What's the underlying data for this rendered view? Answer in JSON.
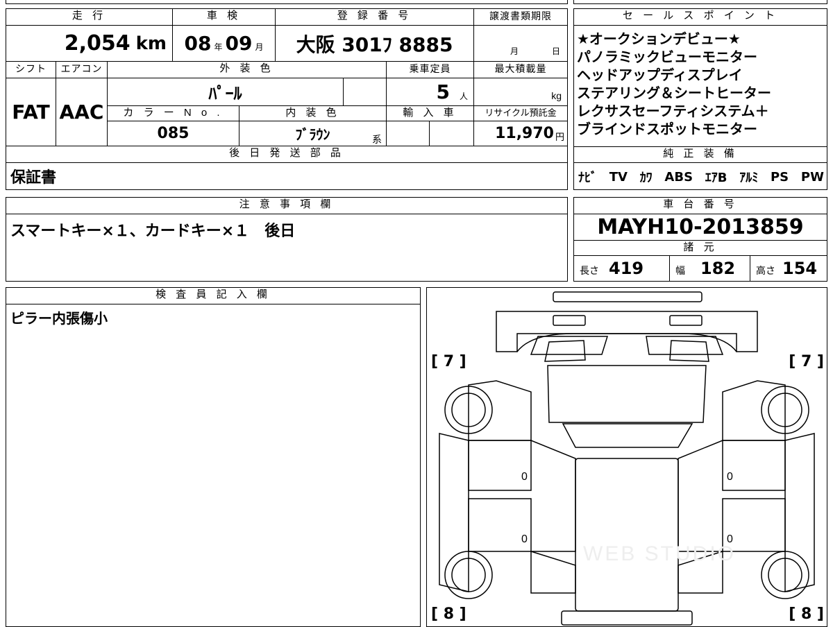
{
  "top": {
    "mileage_label": "走 行",
    "mileage_value": "2,054",
    "mileage_unit": "km",
    "shaken_label": "車 検",
    "shaken_year": "08",
    "shaken_year_unit": "年",
    "shaken_month": "09",
    "shaken_month_unit": "月",
    "reg_label": "登 録 番 号",
    "reg_value": "大阪 301ﾌ 8885",
    "deadline_label": "譲渡書類期限",
    "deadline_month_unit": "月",
    "deadline_day_unit": "日",
    "shift_label": "シフト",
    "shift_value": "FAT",
    "ac_label": "エアコン",
    "ac_value": "AAC",
    "exterior_label": "外 装 色",
    "exterior_value": "ﾊﾟｰﾙ",
    "capacity_label": "乗車定員",
    "capacity_value": "5",
    "capacity_unit": "人",
    "maxload_label": "最大積載量",
    "maxload_unit": "kg",
    "color_no_label": "カ ラ ー N o .",
    "color_no_value": "085",
    "interior_label": "内 装 色",
    "interior_value": "ﾌﾞﾗｳﾝ",
    "interior_suffix": "系",
    "import_label": "輸 入 車",
    "recycle_label": "リサイクル預託金",
    "recycle_value": "11,970",
    "recycle_unit": "円",
    "later_label": "後 日 発 送 部 品",
    "later_value": "保証書"
  },
  "sales": {
    "label": "セ ー ル ス ポ イ ン ト",
    "points": [
      "★オークションデビュー★",
      "パノラミックビューモニター",
      "ヘッドアップディスプレイ",
      "ステアリング＆シートヒーター",
      "レクサスセーフティシステム＋",
      "ブラインドスポットモニター"
    ]
  },
  "equipment": {
    "label": "純 正 装 備",
    "items": [
      "ﾅﾋﾞ",
      "TV",
      "ｶﾜ",
      "ABS",
      "ｴｱB",
      "ｱﾙﾐ",
      "PS",
      "PW"
    ]
  },
  "notes": {
    "label": "注 意 事 項 欄",
    "value": "スマートキー×１、カードキー×１　後日"
  },
  "chassis": {
    "label": "車 台 番 号",
    "value": "MAYH10-2013859"
  },
  "specs": {
    "label": "諸 元",
    "length_label": "長さ",
    "length_value": "419",
    "width_label": "幅",
    "width_value": "182",
    "height_label": "高さ",
    "height_value": "154"
  },
  "inspector": {
    "label": "検 査 員 記 入 欄",
    "value": "ピラー内張傷小"
  },
  "diagram": {
    "corner_tl": "[ 7 ]",
    "corner_tr": "[ 7 ]",
    "corner_bl": "[ 8 ]",
    "corner_br": "[ 8 ]",
    "door_marks": [
      "0",
      "0",
      "0",
      "0"
    ],
    "watermark": "WEB STUDIO"
  }
}
